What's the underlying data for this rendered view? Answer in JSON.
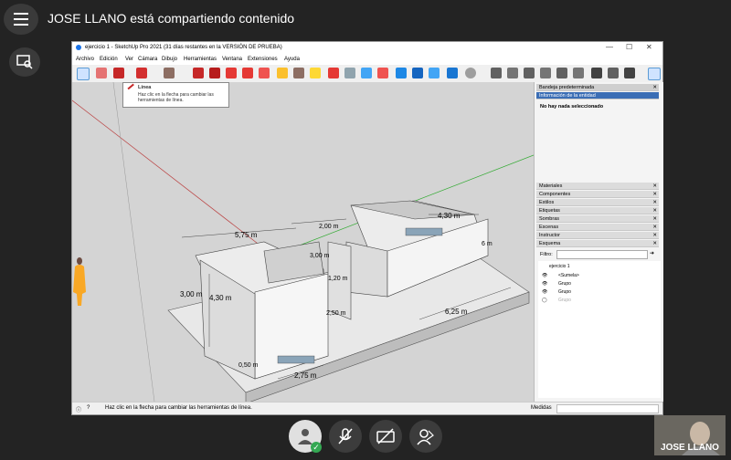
{
  "meeting": {
    "title": "JOSE LLANO está compartiendo contenido",
    "participant_name": "JOSE LLANO"
  },
  "sketchup": {
    "window_title": "ejercicio 1 - SketchUp Pro 2021 (31 días restantes en la VERSIÓN DE PRUEBA)",
    "menu": [
      "Archivo",
      "Edición",
      "Ver",
      "Cámara",
      "Dibujo",
      "Herramientas",
      "Ventana",
      "Extensiones",
      "Ayuda"
    ],
    "tooltip": {
      "title": "Línea",
      "body": "Haz clic en la flecha para cambiar las herramientas de línea."
    },
    "dimensions": [
      "5,75 m",
      "4,30 m",
      "3,00 m",
      "4,30 m",
      "2,00 m",
      "3,00 m",
      "2,50 m",
      "2,75 m",
      "6,25 m",
      "6 m",
      "0,50 m",
      "1,20 m"
    ],
    "tray": {
      "title": "Bandeja predeterminada",
      "entity_info": "Información de la entidad",
      "no_selection": "No hay nada seleccionado",
      "panels": [
        "Materiales",
        "Componentes",
        "Estilos",
        "Etiquetas",
        "Sombras",
        "Escenas",
        "Instructor",
        "Esquema"
      ],
      "filter_label": "Filtro:",
      "outline": {
        "root": "ejercicio 1",
        "items": [
          "<Sumela>",
          "Grupo",
          "Grupo",
          "Grupo"
        ]
      }
    },
    "status": {
      "message": "Haz clic en la flecha para cambiar las herramientas de línea.",
      "measures_label": "Medidas"
    }
  },
  "colors": {
    "accent": "#1a73e8",
    "bg": "#232323",
    "viewport": "#d4d4d4"
  }
}
